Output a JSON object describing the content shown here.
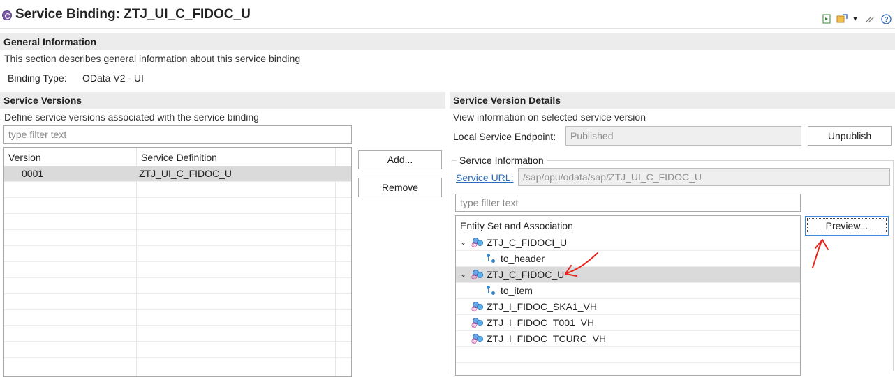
{
  "header": {
    "title": "Service Binding: ZTJ_UI_C_FIDOC_U"
  },
  "general": {
    "title": "General Information",
    "description": "This section describes general information about this service binding",
    "binding_type_label": "Binding Type:",
    "binding_type_value": "OData V2 - UI"
  },
  "versions": {
    "title": "Service Versions",
    "description": "Define service versions associated with the service binding",
    "filter_placeholder": "type filter text",
    "columns": [
      "Version",
      "Service Definition"
    ],
    "rows": [
      {
        "version": "0001",
        "definition": "ZTJ_UI_C_FIDOC_U"
      }
    ],
    "add_label": "Add...",
    "remove_label": "Remove"
  },
  "details": {
    "title": "Service Version Details",
    "description": "View information on selected service version",
    "endpoint_label": "Local Service Endpoint:",
    "endpoint_value": "Published",
    "unpublish_label": "Unpublish",
    "service_info_label": "Service Information",
    "service_url_label": "Service URL:",
    "service_url_value": "/sap/opu/odata/sap/ZTJ_UI_C_FIDOC_U",
    "filter_placeholder": "type filter text",
    "tree_header": "Entity Set and Association",
    "preview_label": "Preview...",
    "tree": {
      "e1": "ZTJ_C_FIDOCI_U",
      "e1_child": "to_header",
      "e2": "ZTJ_C_FIDOC_U",
      "e2_child": "to_item",
      "e3": "ZTJ_I_FIDOC_SKA1_VH",
      "e4": "ZTJ_I_FIDOC_T001_VH",
      "e5": "ZTJ_I_FIDOC_TCURC_VH"
    }
  },
  "colors": {
    "annotation": "#e8241c",
    "link": "#2a6ebb",
    "selected_row": "#dadada"
  }
}
